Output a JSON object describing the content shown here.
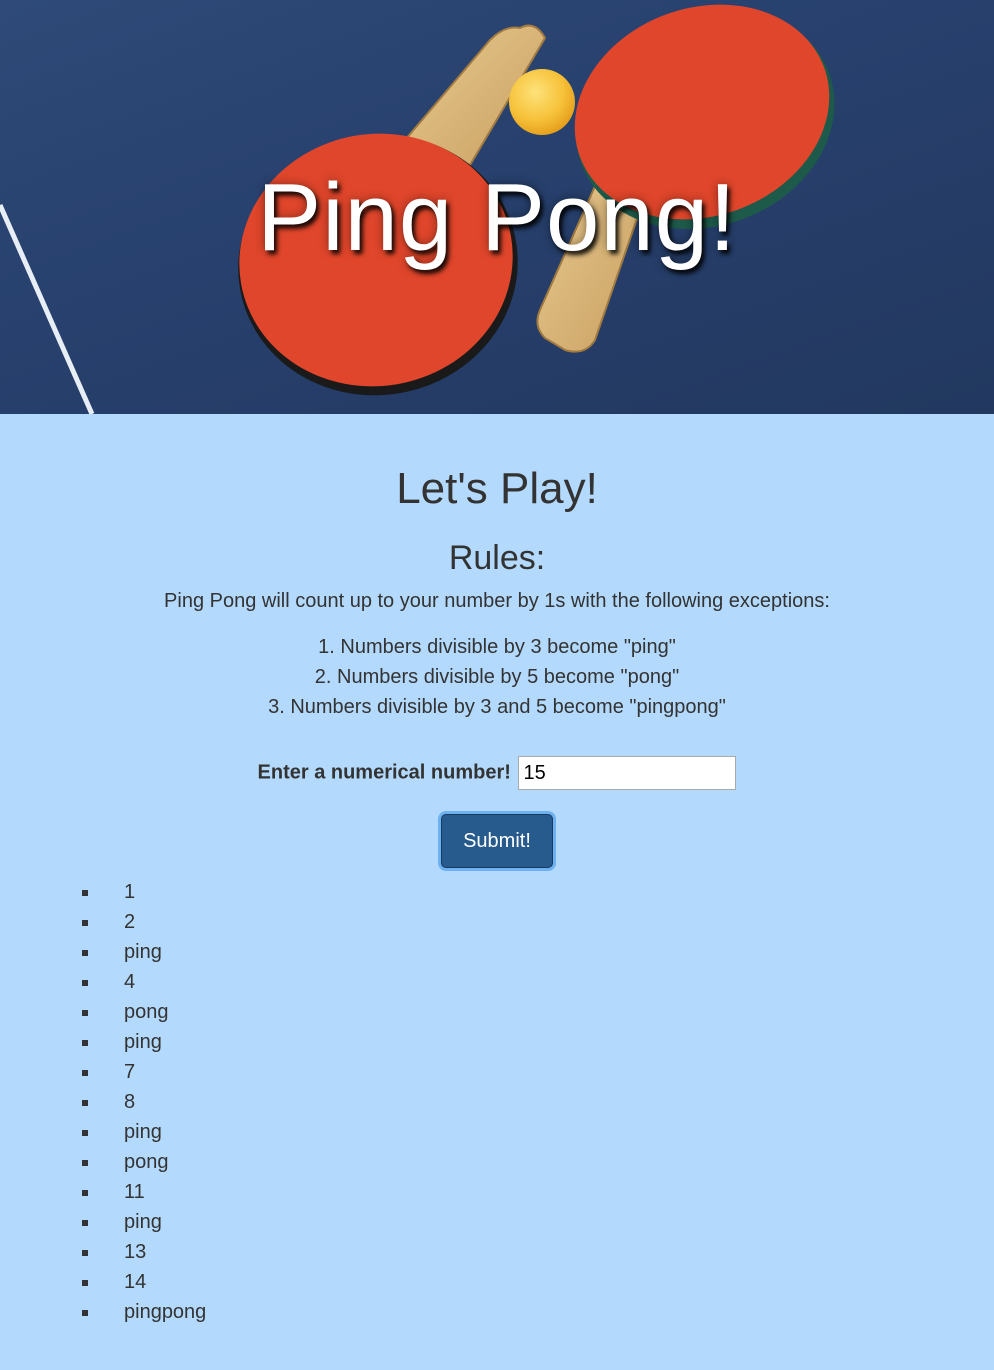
{
  "hero": {
    "title": "Ping Pong!"
  },
  "main": {
    "heading": "Let's Play!",
    "rules_heading": "Rules:",
    "intro": "Ping Pong will count up to your number by 1s with the following exceptions:",
    "rules": [
      "1. Numbers divisible by 3 become \"ping\"",
      "2. Numbers divisible by 5 become \"pong\"",
      "3. Numbers divisible by 3 and 5 become \"pingpong\""
    ]
  },
  "form": {
    "label": "Enter a numerical number!",
    "value": "15",
    "submit_label": "Submit!"
  },
  "results": [
    "1",
    "2",
    "ping",
    "4",
    "pong",
    "ping",
    "7",
    "8",
    "ping",
    "pong",
    "11",
    "ping",
    "13",
    "14",
    "pingpong"
  ],
  "colors": {
    "page_background": "#b3d9fc",
    "text": "#333333",
    "button": "#275b8e",
    "button_focus_ring": "#6eb1f0",
    "paddle_red": "#e0462b",
    "ball": "#f7c23a"
  }
}
